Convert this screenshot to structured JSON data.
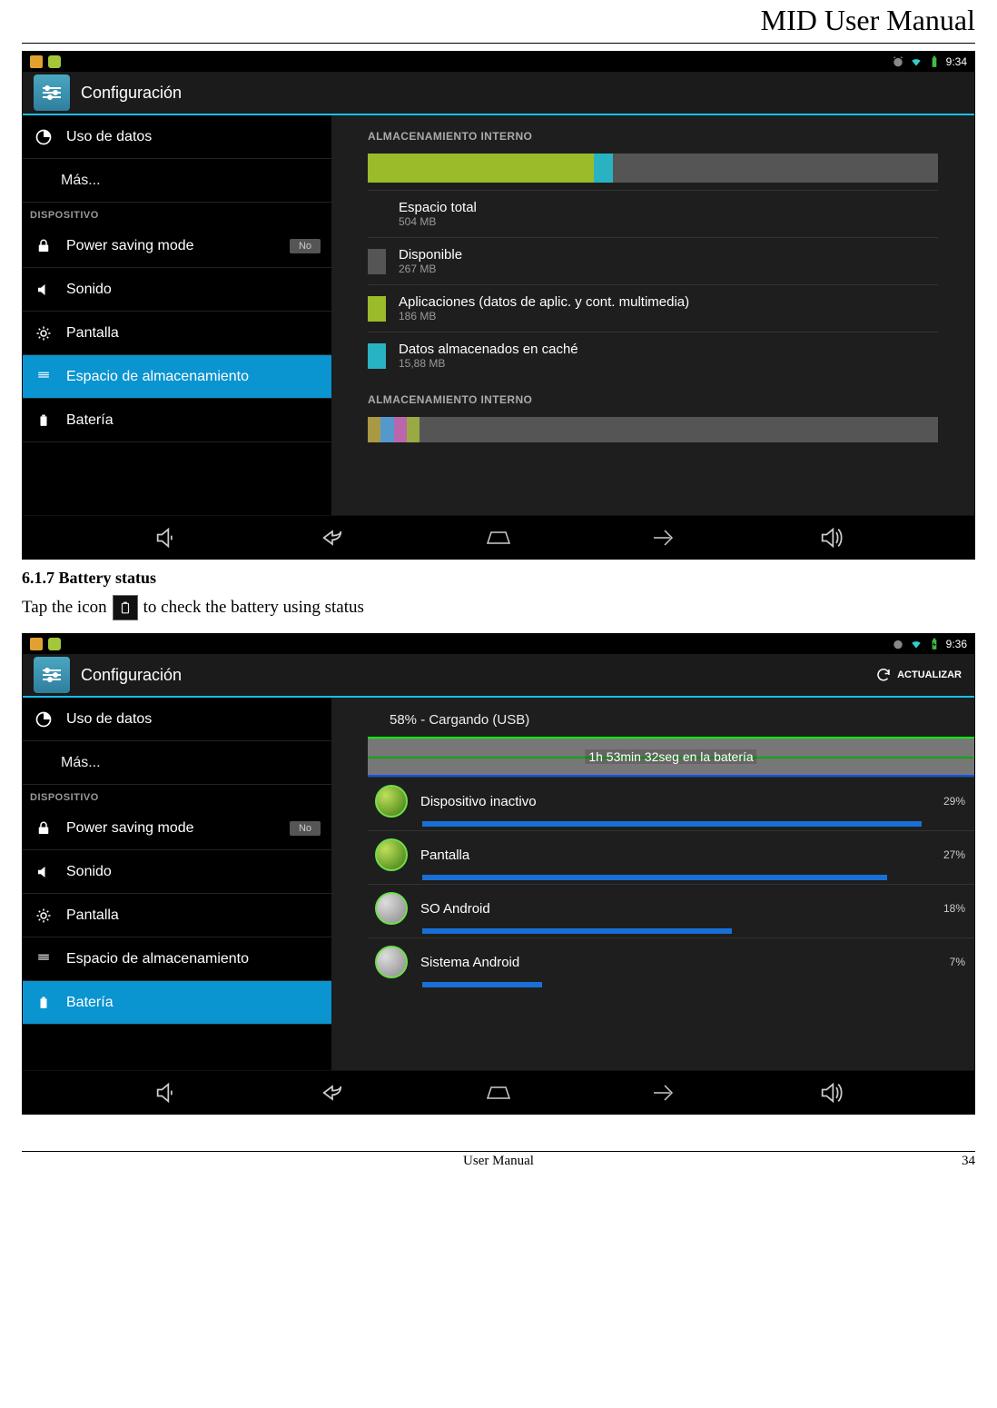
{
  "doc": {
    "header": "MID User Manual",
    "section_num": "6.1.7 Battery status",
    "instr_pre": "Tap the icon",
    "instr_post": "to check the battery using status",
    "footer_center": "User Manual",
    "footer_page": "34"
  },
  "shot1": {
    "time": "9:34",
    "title": "Configuración",
    "sidebar": {
      "data_usage": "Uso de datos",
      "more": "Más...",
      "section_device": "DISPOSITIVO",
      "power_saving": "Power saving mode",
      "toggle_no": "No",
      "sound": "Sonido",
      "display": "Pantalla",
      "storage": "Espacio de almacenamiento",
      "battery": "Batería"
    },
    "main": {
      "header1": "ALMACENAMIENTO INTERNO",
      "total_label": "Espacio total",
      "total_val": "504 MB",
      "avail_label": "Disponible",
      "avail_val": "267 MB",
      "apps_label": "Aplicaciones (datos de aplic. y cont. multimedia)",
      "apps_val": "186 MB",
      "cache_label": "Datos almacenados en caché",
      "cache_val": "15,88 MB",
      "header2": "ALMACENAMIENTO INTERNO"
    }
  },
  "shot2": {
    "time": "9:36",
    "title": "Configuración",
    "refresh": "ACTUALIZAR",
    "sidebar": {
      "data_usage": "Uso de datos",
      "more": "Más...",
      "section_device": "DISPOSITIVO",
      "power_saving": "Power saving mode",
      "toggle_no": "No",
      "sound": "Sonido",
      "display": "Pantalla",
      "storage": "Espacio de almacenamiento",
      "battery": "Batería"
    },
    "main": {
      "status": "58% - Cargando (USB)",
      "chart_label": "1h 53min 32seg en la batería",
      "rows": [
        {
          "label": "Dispositivo inactivo",
          "pct": "29%",
          "bar": 100
        },
        {
          "label": "Pantalla",
          "pct": "27%",
          "bar": 93
        },
        {
          "label": "SO Android",
          "pct": "18%",
          "bar": 62
        },
        {
          "label": "Sistema Android",
          "pct": "7%",
          "bar": 24
        }
      ]
    }
  },
  "chart_data": [
    {
      "type": "bar",
      "title": "ALMACENAMIENTO INTERNO (usage)",
      "total_mb": 504,
      "segments": [
        {
          "name": "Aplicaciones",
          "value_mb": 186,
          "color": "#9bbb2a"
        },
        {
          "name": "Caché",
          "value_mb": 15.88,
          "color": "#29b3c2"
        },
        {
          "name": "Disponible",
          "value_mb": 267,
          "color": "#555555"
        }
      ]
    },
    {
      "type": "bar",
      "title": "Battery usage by app",
      "ylabel": "%",
      "categories": [
        "Dispositivo inactivo",
        "Pantalla",
        "SO Android",
        "Sistema Android"
      ],
      "values": [
        29,
        27,
        18,
        7
      ]
    }
  ]
}
